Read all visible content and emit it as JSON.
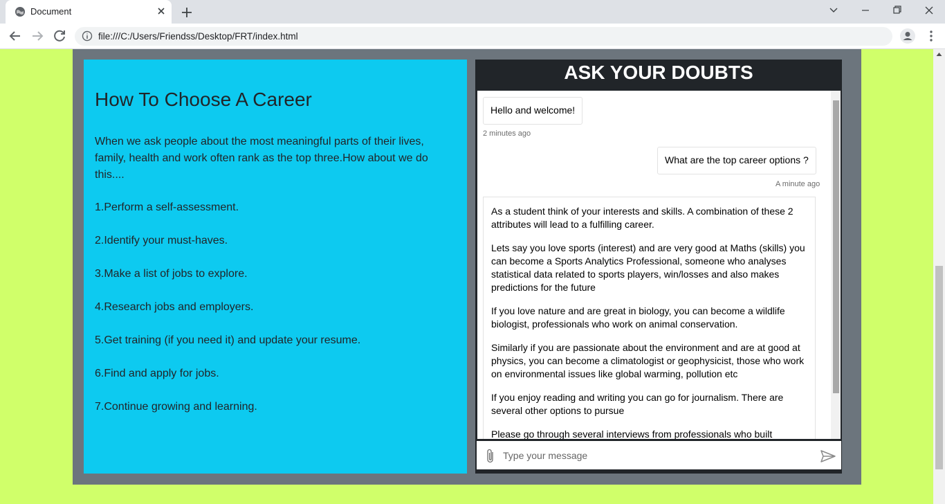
{
  "browser": {
    "tab_title": "Document",
    "url": "file:///C:/Users/Friendss/Desktop/FRT/index.html"
  },
  "left": {
    "title": "How To Choose A Career",
    "intro": "When we ask people about the most meaningful parts of their lives, family, health and work often rank as the top three.How about we do this....",
    "steps": [
      "1.Perform a self-assessment.",
      "2.Identify your must-haves.",
      "3.Make a list of jobs to explore.",
      "4.Research jobs and employers.",
      "5.Get training (if you need it) and update your resume.",
      "6.Find and apply for jobs.",
      "7.Continue growing and learning."
    ]
  },
  "chat": {
    "header": "ASK YOUR DOUBTS",
    "messages": [
      {
        "text": "Hello and welcome!",
        "time": "2 minutes ago"
      },
      {
        "text": "What are the top career options ?",
        "time": "A minute ago"
      }
    ],
    "long_reply": [
      "As a student think of your interests and skills. A combination of these 2 attributes will lead to a fulfilling career.",
      "Lets say you love sports (interest) and are very good at Maths (skills) you can become a Sports Analytics Professional, someone who analyses statistical data related to sports players, win/losses and also makes predictions for the future",
      "If you love nature and are great in biology, you can become a wildlife biologist, professionals who work on animal conservation.",
      "Similarly if you are passionate about the environment and are at good at physics, you can become a climatologist or geophysicist, those who work on environmental issues like global warming, pollution etc",
      "If you enjoy reading and writing you can go for journalism. There are several other options to pursue",
      "Please go through several interviews from professionals who built"
    ],
    "input_placeholder": "Type your message"
  },
  "colors": {
    "page_bg": "#d0ff6a",
    "frame": "#6c757d",
    "left_panel": "#0dcaf0",
    "chat_header": "#212529"
  }
}
